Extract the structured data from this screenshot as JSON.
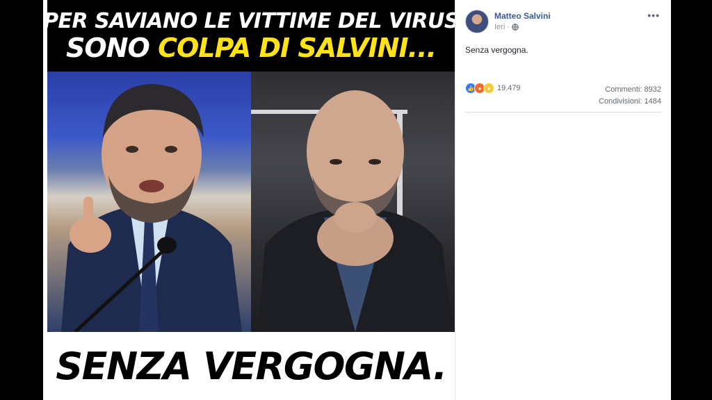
{
  "image": {
    "headline_line1": "Per Saviano le vittime del virus",
    "headline_line2_white": "Sono ",
    "headline_line2_yellow": "colpa di Salvini...",
    "bottom_text": "Senza vergogna."
  },
  "post": {
    "author": "Matteo Salvini",
    "time": "Ieri",
    "privacy_icon": "globe-icon",
    "more_icon": "more-options-icon",
    "text": "Senza vergogna.",
    "reactions": {
      "icons": [
        "like-reaction-icon",
        "angry-reaction-icon",
        "haha-reaction-icon"
      ],
      "count": "19.479"
    },
    "comments_label": "Commenti: 8932",
    "shares_label": "Condivisioni: 1484"
  },
  "colors": {
    "link_blue": "#385898",
    "headline_yellow": "#ffe21a",
    "like_blue": "#2e7cf6",
    "angry_orange": "#f06a2a",
    "haha_yellow": "#f7c93c"
  }
}
